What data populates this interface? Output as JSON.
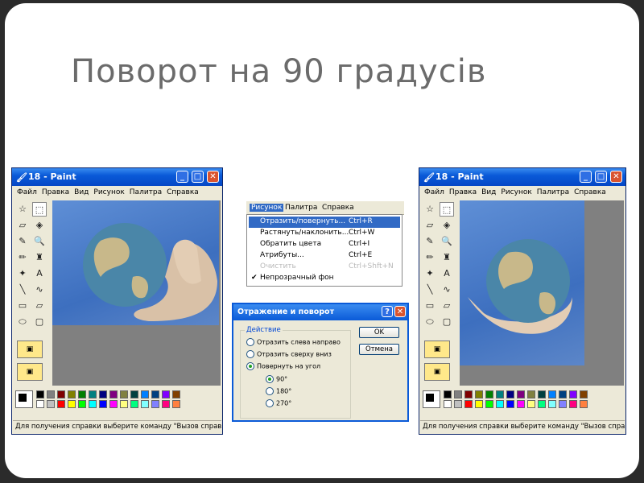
{
  "slide": {
    "title": "Поворот на 90 градусів"
  },
  "paint_left": {
    "title": "18 - Paint",
    "menu": [
      "Файл",
      "Правка",
      "Вид",
      "Рисунок",
      "Палитра",
      "Справка"
    ],
    "status": "Для получения справки выберите команду \"Вызов справк"
  },
  "paint_right": {
    "title": "18 - Paint",
    "menu": [
      "Файл",
      "Правка",
      "Вид",
      "Рисунок",
      "Палитра",
      "Справка"
    ],
    "status": "Для получения справки выберите команду \"Вызов справк"
  },
  "tools": {
    "icons": [
      "free-select-icon",
      "rect-select-icon",
      "eraser-icon",
      "fill-icon",
      "picker-icon",
      "magnifier-icon",
      "pencil-icon",
      "brush-icon",
      "airbrush-icon",
      "text-icon",
      "line-icon",
      "curve-icon",
      "rectangle-icon",
      "polygon-icon",
      "ellipse-icon",
      "rounded-rect-icon"
    ],
    "glyphs": [
      "☆",
      "⬚",
      "▱",
      "◈",
      "✎",
      "🔍",
      "✏",
      "♜",
      "✦",
      "A",
      "╲",
      "∿",
      "▭",
      "▱",
      "⬭",
      "▢"
    ]
  },
  "palette": {
    "colors": [
      "#000000",
      "#808080",
      "#800000",
      "#808000",
      "#008000",
      "#008080",
      "#000080",
      "#800080",
      "#808040",
      "#004040",
      "#0080ff",
      "#004080",
      "#8000ff",
      "#804000",
      "#ffffff",
      "#c0c0c0",
      "#ff0000",
      "#ffff00",
      "#00ff00",
      "#00ffff",
      "#0000ff",
      "#ff00ff",
      "#ffff80",
      "#00ff80",
      "#80ffff",
      "#8080ff",
      "#ff0080",
      "#ff8040"
    ]
  },
  "menu_popup": {
    "bar": [
      "Рисунок",
      "Палитра",
      "Справка"
    ],
    "items": [
      {
        "label": "Отразить/повернуть...",
        "shortcut": "Ctrl+R"
      },
      {
        "label": "Растянуть/наклонить...",
        "shortcut": "Ctrl+W"
      },
      {
        "label": "Обратить цвета",
        "shortcut": "Ctrl+I"
      },
      {
        "label": "Атрибуты...",
        "shortcut": "Ctrl+E"
      },
      {
        "label": "Очистить",
        "shortcut": "Ctrl+Shft+N"
      },
      {
        "label": "Непрозрачный фон",
        "shortcut": ""
      }
    ],
    "checkmark": "✔"
  },
  "dialog": {
    "title": "Отражение и поворот",
    "help": "?",
    "close": "✕",
    "group_label": "Действие",
    "options": [
      "Отразить слева направо",
      "Отразить сверху вниз",
      "Повернуть на угол"
    ],
    "angles": [
      "90°",
      "180°",
      "270°"
    ],
    "ok": "OK",
    "cancel": "Отмена"
  },
  "colors": {
    "accent": "#0a5ad8",
    "highlight": "#316ac5",
    "sky": "#4f7fcf"
  }
}
